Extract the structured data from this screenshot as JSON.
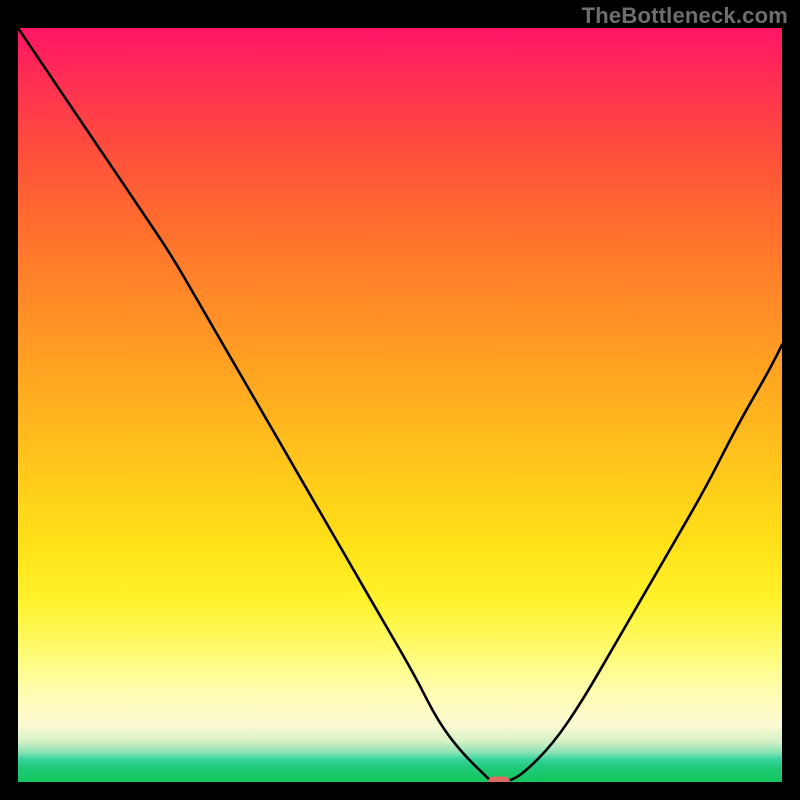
{
  "watermark": "TheBottleneck.com",
  "colors": {
    "page_bg": "#000000",
    "watermark": "#6e6e6e",
    "curve_stroke": "#000000",
    "marker_fill": "#d96b63",
    "gradient_top": "#ff1466",
    "gradient_bottom": "#14c75e"
  },
  "chart_data": {
    "type": "line",
    "title": "",
    "xlabel": "",
    "ylabel": "",
    "xlim": [
      0,
      100
    ],
    "ylim": [
      0,
      100
    ],
    "grid": false,
    "series": [
      {
        "name": "bottleneck-curve",
        "x": [
          0,
          4,
          8,
          12,
          16,
          20,
          24,
          28,
          32,
          36,
          40,
          44,
          48,
          52,
          55,
          58,
          61,
          62,
          64,
          66,
          70,
          74,
          78,
          82,
          86,
          90,
          94,
          98,
          100
        ],
        "values": [
          100,
          94,
          88,
          82,
          76,
          70,
          63,
          56,
          49,
          42,
          35,
          28,
          21,
          14,
          8,
          4,
          1,
          0,
          0,
          1,
          5,
          11,
          18,
          25,
          32,
          39,
          47,
          54,
          58
        ]
      }
    ],
    "marker": {
      "x": 63,
      "y": 0,
      "color": "#d96b63"
    }
  }
}
